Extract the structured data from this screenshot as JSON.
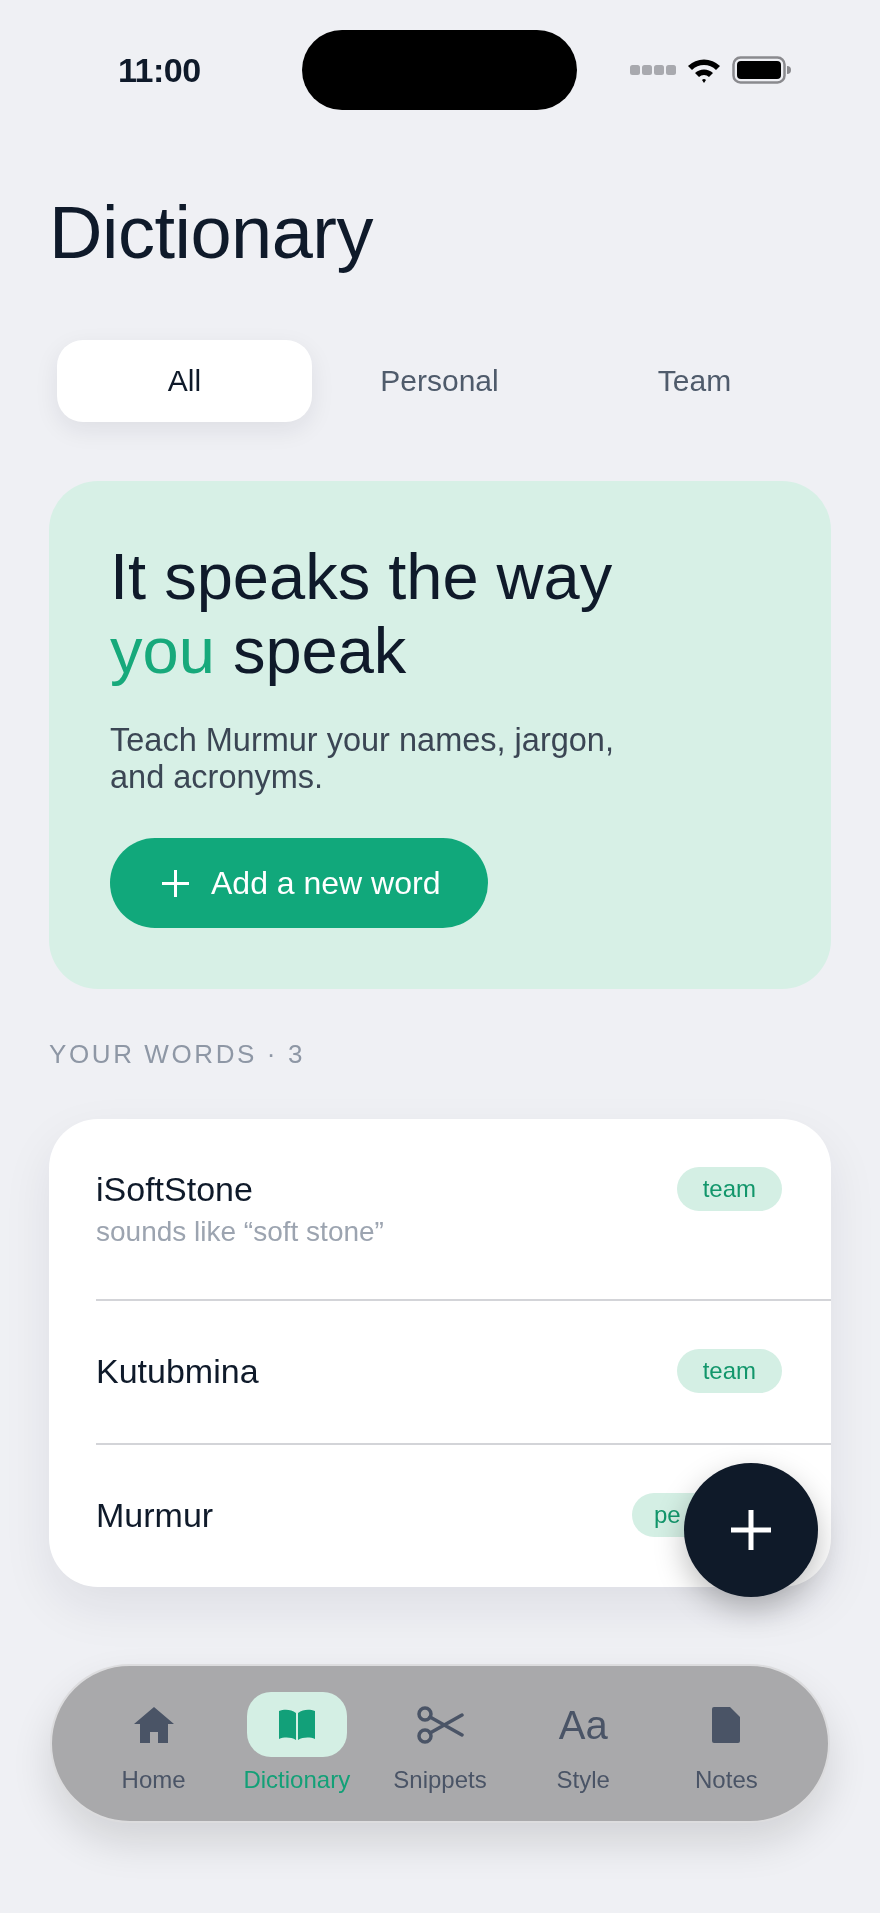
{
  "status_bar": {
    "time": "11:00"
  },
  "title": "Dictionary",
  "tabs": [
    {
      "label": "All",
      "selected": true
    },
    {
      "label": "Personal",
      "selected": false
    },
    {
      "label": "Team",
      "selected": false
    }
  ],
  "hero": {
    "headline": [
      {
        "text": "It speaks the way",
        "highlight": false
      },
      {
        "text": "you",
        "highlight": true
      },
      {
        "text": "speak",
        "highlight": false
      }
    ],
    "description": "Teach Murmur your names, jargon, and acronyms.",
    "button": {
      "label": "Add a new word"
    }
  },
  "section_label": "YOUR WORDS · 3",
  "words": [
    {
      "term": "iSoftStone",
      "pronunciation": "sounds like “soft stone”",
      "tag": "team",
      "tag_partly_hidden": false
    },
    {
      "term": "Kutubmina",
      "tag": "team",
      "tag_partly_hidden": false
    },
    {
      "term": "Murmur",
      "tag": "pe",
      "tag_partly_hidden": true
    }
  ],
  "tab_bar": {
    "items": [
      {
        "label": "Home",
        "selected": false
      },
      {
        "label": "Dictionary",
        "selected": true
      },
      {
        "label": "Snippets",
        "selected": false
      },
      {
        "glyph": "Aa",
        "label": "Style",
        "selected": false
      },
      {
        "label": "Notes",
        "selected": false
      }
    ]
  }
}
